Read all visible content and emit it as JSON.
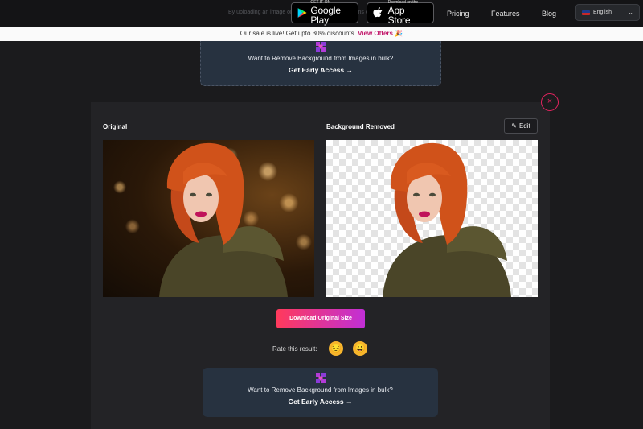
{
  "nav": {
    "hint_text": "By uploading an image or URL you agree to our Terms of Service",
    "google_play": {
      "small": "GET IT ON",
      "big": "Google Play"
    },
    "app_store": {
      "small": "Download on the",
      "big": "App Store"
    },
    "links": [
      "Pricing",
      "Features",
      "Blog"
    ],
    "language": "English"
  },
  "banner": {
    "text": "Our sale is live! Get upto 30% discounts.",
    "offer_link": "View Offers",
    "emoji": "🎉"
  },
  "bulk_card": {
    "text": "Want to Remove Background from Images in bulk?",
    "cta": "Get Early Access →"
  },
  "result": {
    "original_label": "Original",
    "removed_label": "Background Removed",
    "edit_label": "Edit",
    "download_label": "Download Original Size",
    "rate_label": "Rate this result:",
    "rate_options": [
      "😔",
      "😀"
    ],
    "close_symbol": "×"
  },
  "colors": {
    "accent": "#e0245e",
    "brand_pink": "#c2186b",
    "card": "#273240"
  }
}
